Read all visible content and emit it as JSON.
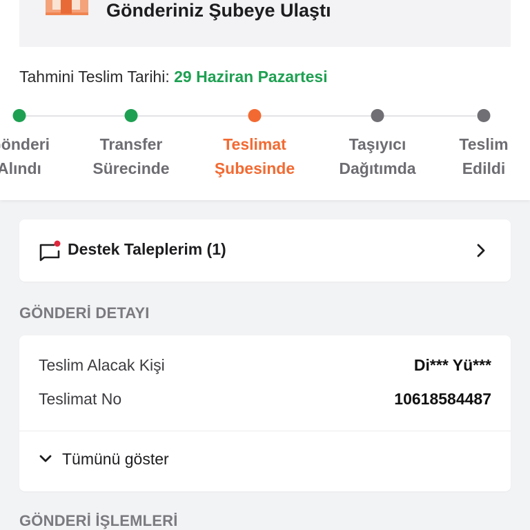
{
  "header": {
    "status_title": "Gönderiniz Şubeye Ulaştı",
    "eta_label": "Tahmini Teslim Tarihi:",
    "eta_date": "29 Haziran Pazartesi"
  },
  "tracker": {
    "steps": [
      {
        "line1": "Gönderi",
        "line2": "Alındı",
        "state": "done"
      },
      {
        "line1": "Transfer",
        "line2": "Sürecinde",
        "state": "done"
      },
      {
        "line1": "Teslimat",
        "line2": "Şubesinde",
        "state": "active"
      },
      {
        "line1": "Taşıyıcı",
        "line2": "Dağıtımda",
        "state": "pending"
      },
      {
        "line1": "Teslim",
        "line2": "Edildi",
        "state": "pending"
      }
    ]
  },
  "support": {
    "label": "Destek Taleplerim (1)",
    "icon": "chat-bubble-notification-icon"
  },
  "shipment_details": {
    "section_title": "GÖNDERİ DETAYI",
    "rows": [
      {
        "key": "Teslim Alacak Kişi",
        "value": "Di*** Yü***"
      },
      {
        "key": "Teslimat No",
        "value": "10618584487"
      }
    ],
    "expand_label": "Tümünü göster"
  },
  "shipment_actions": {
    "section_title": "GÖNDERİ İŞLEMLERİ"
  },
  "colors": {
    "accent_green": "#1ea052",
    "accent_orange": "#f26a32",
    "pending_gray": "#6f6f74",
    "notification_red": "#e0283c"
  }
}
